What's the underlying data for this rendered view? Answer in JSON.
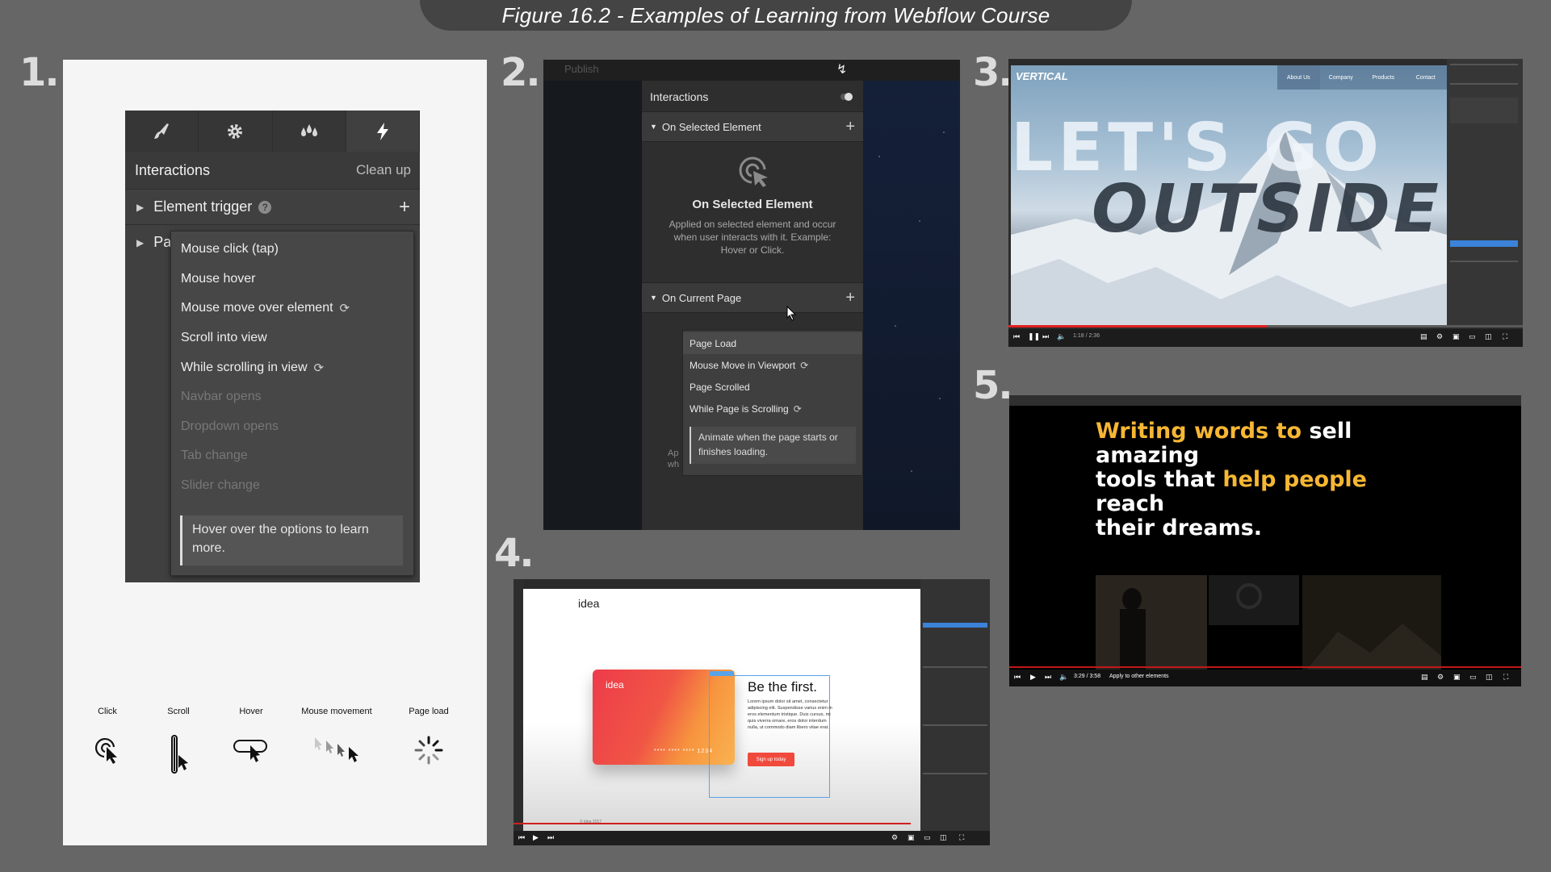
{
  "figure_title": "Figure 16.2 - Examples of Learning from Webflow Course",
  "panel_numbers": [
    "1.",
    "2.",
    "3.",
    "4.",
    "5."
  ],
  "panel1": {
    "tabs": [
      "brush-icon",
      "gear-icon",
      "drops-icon",
      "lightning-icon"
    ],
    "header_title": "Interactions",
    "header_action": "Clean up",
    "row1_label": "Element trigger",
    "row2_label": "Pa",
    "menu_items": [
      {
        "label": "Mouse click (tap)",
        "disabled": false,
        "sync": false
      },
      {
        "label": "Mouse hover",
        "disabled": false,
        "sync": false
      },
      {
        "label": "Mouse move over element",
        "disabled": false,
        "sync": true
      },
      {
        "label": "Scroll into view",
        "disabled": false,
        "sync": false
      },
      {
        "label": "While scrolling in view",
        "disabled": false,
        "sync": true
      },
      {
        "label": "Navbar opens",
        "disabled": true,
        "sync": false
      },
      {
        "label": "Dropdown opens",
        "disabled": true,
        "sync": false
      },
      {
        "label": "Tab change",
        "disabled": true,
        "sync": false
      },
      {
        "label": "Slider change",
        "disabled": true,
        "sync": false
      }
    ],
    "hint": "Hover over the options to learn more.",
    "trigger_icons": [
      {
        "label": "Click",
        "icon": "click-icon"
      },
      {
        "label": "Scroll",
        "icon": "scroll-icon"
      },
      {
        "label": "Hover",
        "icon": "hover-icon"
      },
      {
        "label": "Mouse movement",
        "icon": "mouse-movement-icon"
      },
      {
        "label": "Page load",
        "icon": "page-load-icon"
      }
    ]
  },
  "panel2": {
    "toolbar_label": "Publish",
    "title": "Interactions",
    "section1": "On Selected Element",
    "empty_title": "On Selected Element",
    "empty_desc": "Applied on selected element and occur when user interacts with it. Example: Hover or Click.",
    "section2": "On Current Page",
    "menu_items": [
      {
        "label": "Page Load",
        "sync": false
      },
      {
        "label": "Mouse Move in Viewport",
        "sync": true
      },
      {
        "label": "Page Scrolled",
        "sync": false
      },
      {
        "label": "While Page is Scrolling",
        "sync": true
      }
    ],
    "hint": "Animate when the page starts or finishes loading.",
    "behind_text": "Ap wh"
  },
  "panel3": {
    "brand": "VERTICAL",
    "nav": [
      "About Us",
      "Company",
      "Products",
      "Contact"
    ],
    "headline1": "LET'S GO",
    "headline2": "OUTSIDE",
    "time": "1:18 / 2:36"
  },
  "panel4": {
    "logo": "idea",
    "card_label": "idea",
    "card_number": "**** **** **** 1234",
    "heading": "Be the first.",
    "body": "Lorem ipsum dolor sit amet, consectetur adipiscing elit. Suspendisse varius enim in eros elementum tristique. Duis cursus, mi quis viverra ornare, eros dolor interdum nulla, ut commodo diam libero vitae erat.",
    "button": "Sign up today",
    "footer": "© idea 2017"
  },
  "panel5": {
    "line1_a": "Writing words to",
    "line1_b": " sell amazing",
    "line2_a": "tools that ",
    "line2_b": "help people",
    "line2_c": " reach",
    "line3": "their dreams.",
    "time": "3:29 / 3:58",
    "chapter": "Apply to other elements",
    "colors": {
      "accent": "#f7b733"
    }
  }
}
